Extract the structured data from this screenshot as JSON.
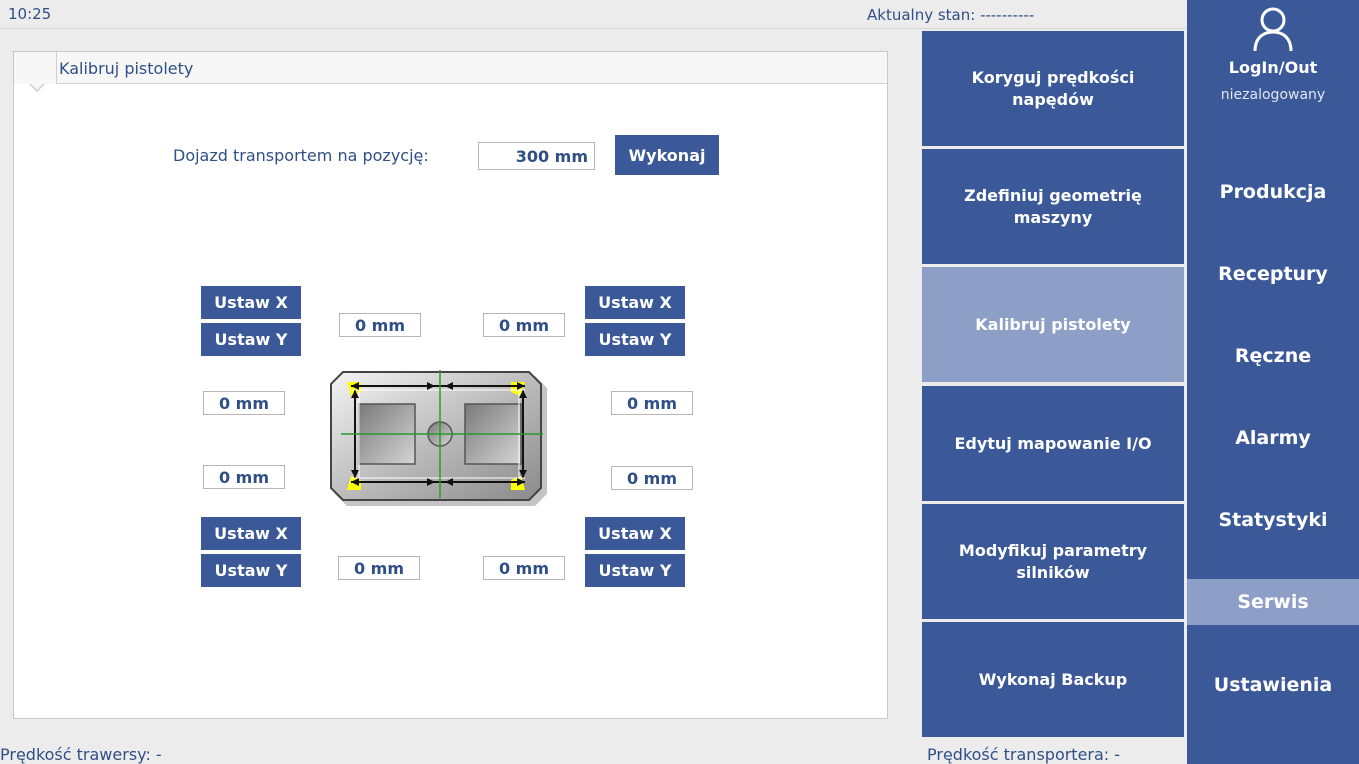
{
  "topbar": {
    "time": "10:25",
    "state": "Aktualny stan: ----------"
  },
  "panel": {
    "title": "Kalibruj pistolety",
    "transport_label": "Dojazd transportem na pozycję:",
    "transport_value": "300 mm",
    "execute_label": "Wykonaj",
    "set_x_label": "Ustaw X",
    "set_y_label": "Ustaw Y",
    "fields": {
      "top_left_x": "0 mm",
      "top_right_x": "0 mm",
      "left_upper_y": "0 mm",
      "left_lower_y": "0 mm",
      "right_upper_y": "0 mm",
      "right_lower_y": "0 mm",
      "bottom_left_x": "0 mm",
      "bottom_right_x": "0 mm"
    }
  },
  "service_menu": [
    {
      "label": "Koryguj prędkości napędów",
      "active": false
    },
    {
      "label": "Zdefiniuj geometrię maszyny",
      "active": false
    },
    {
      "label": "Kalibruj pistolety",
      "active": true
    },
    {
      "label": "Edytuj mapowanie I/O",
      "active": false
    },
    {
      "label": "Modyfikuj parametry silników",
      "active": false
    },
    {
      "label": "Wykonaj Backup",
      "active": false
    }
  ],
  "main_nav": {
    "login_label": "LogIn/Out",
    "login_status": "niezalogowany",
    "items": [
      {
        "label": "Produkcja",
        "active": false
      },
      {
        "label": "Receptury",
        "active": false
      },
      {
        "label": "Ręczne",
        "active": false
      },
      {
        "label": "Alarmy",
        "active": false
      },
      {
        "label": "Statystyki",
        "active": false
      },
      {
        "label": "Serwis",
        "active": true
      },
      {
        "label": "Ustawienia",
        "active": false
      }
    ]
  },
  "statusbar": {
    "traverse_speed": "Prędkość trawersy:  -",
    "transporter_speed": "Prędkość transportera:  -"
  },
  "colors": {
    "accent": "#3b5998",
    "active": "#8d9fc6",
    "text": "#2f4f86"
  }
}
